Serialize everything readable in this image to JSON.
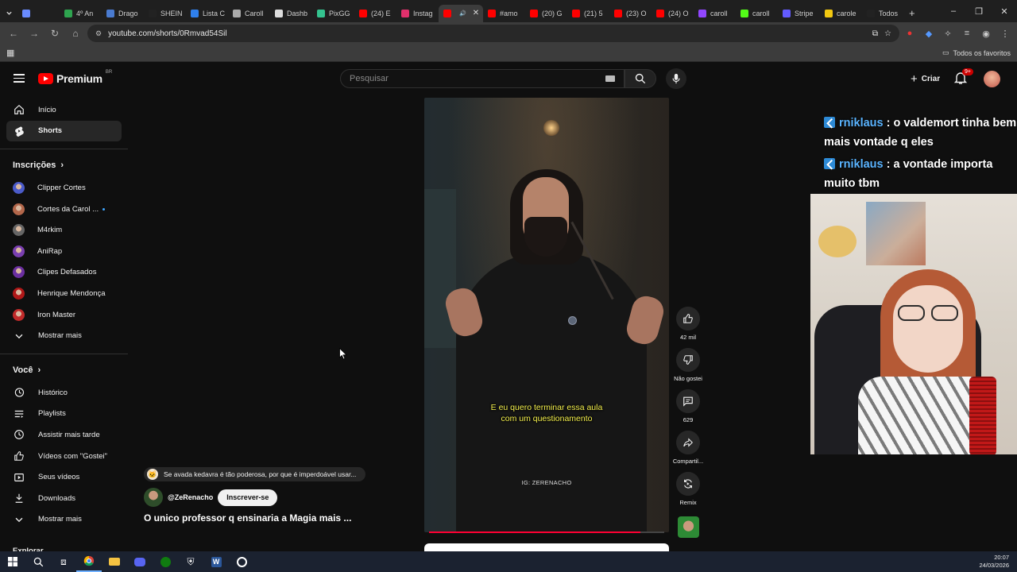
{
  "browser": {
    "tabs": [
      {
        "label": "",
        "color": "#6a8cff"
      },
      {
        "label": "4º An",
        "color": "#2ea44f"
      },
      {
        "label": "Drago",
        "color": "#4a7bd0"
      },
      {
        "label": "SHEIN",
        "color": "#222222"
      },
      {
        "label": "Lista C",
        "color": "#2f80ed"
      },
      {
        "label": "Caroll",
        "color": "#aaaaaa"
      },
      {
        "label": "Dashb",
        "color": "#dddddd"
      },
      {
        "label": "PixGG",
        "color": "#34c38f"
      },
      {
        "label": "(24) E",
        "color": "#ff0000"
      },
      {
        "label": "Instag",
        "color": "#e1306c"
      },
      {
        "label": "",
        "color": "#ff0000",
        "active": true
      },
      {
        "label": "#amo",
        "color": "#ff0000"
      },
      {
        "label": "(20) G",
        "color": "#ff0000"
      },
      {
        "label": "(21) 5",
        "color": "#ff0000"
      },
      {
        "label": "(23) O",
        "color": "#ff0000"
      },
      {
        "label": "(24) O",
        "color": "#ff0000"
      },
      {
        "label": "caroll",
        "color": "#9146ff"
      },
      {
        "label": "caroll",
        "color": "#53fc18"
      },
      {
        "label": "Stripe",
        "color": "#635bff"
      },
      {
        "label": "carole",
        "color": "#f2c811"
      },
      {
        "label": "Todos",
        "color": "#222222"
      }
    ],
    "url": "youtube.com/shorts/0Rmvad54Sil",
    "bookmarks_all": "Todos os favoritos"
  },
  "header": {
    "logo_text": "Premium",
    "logo_country": "BR",
    "search_placeholder": "Pesquisar",
    "create_label": "Criar",
    "notif_count": "9+"
  },
  "sidebar": {
    "home": "Início",
    "shorts": "Shorts",
    "subscriptions_title": "Inscrições",
    "channels": [
      {
        "name": "Clipper Cortes",
        "color": "#4b5bc9"
      },
      {
        "name": "Cortes da Carol ...",
        "color": "#b3674b"
      },
      {
        "name": "M4rkim",
        "color": "#666666"
      },
      {
        "name": "AniRap",
        "color": "#7a3fb0"
      },
      {
        "name": "Clipes Defasados",
        "color": "#6b2fa0"
      },
      {
        "name": "Henrique Mendonça",
        "color": "#b01818"
      },
      {
        "name": "Iron Master",
        "color": "#c02a2a"
      }
    ],
    "show_more_1": "Mostrar mais",
    "you_title": "Você",
    "you_items": [
      "Histórico",
      "Playlists",
      "Assistir mais tarde",
      "Vídeos com \"Gostei\"",
      "Seus vídeos",
      "Downloads"
    ],
    "show_more_2": "Mostrar mais",
    "explore": "Explorar"
  },
  "video": {
    "caption_line1": "E eu quero terminar essa aula",
    "caption_line2": "com um questionamento",
    "watermark": "IG: ZERENACHO",
    "progress": 0.9,
    "suggestion": "Se avada kedavra é tão poderosa, por que é imperdoável usar...",
    "channel": "@ZeRenacho",
    "subscribe": "Inscrever-se",
    "title": "O unico professor q ensinaria a Magia mais ..."
  },
  "actions": {
    "likes": "42 mil",
    "dislike": "Não gostei",
    "comments": "629",
    "share": "Compartil...",
    "remix": "Remix"
  },
  "stream": {
    "chat": [
      {
        "user": "rniklaus",
        "text": "o valdemort tinha bem mais vontade q eles"
      },
      {
        "user": "rniklaus",
        "text": "a vontade importa muito tbm"
      }
    ]
  },
  "taskbar": {
    "time": "20:07",
    "date": "24/03/2026"
  }
}
